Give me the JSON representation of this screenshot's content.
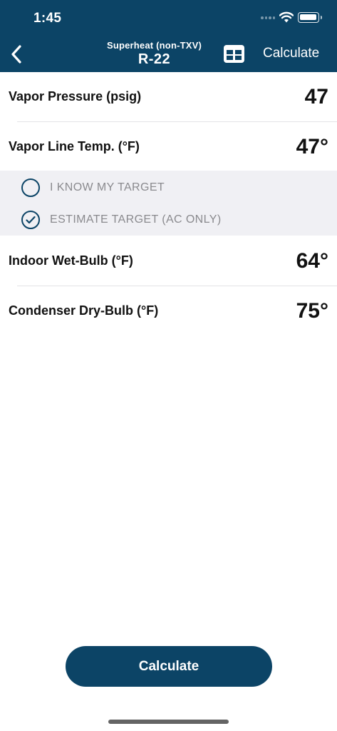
{
  "status_bar": {
    "time": "1:45",
    "icons": [
      "signal-icon",
      "wifi-icon",
      "battery-icon"
    ]
  },
  "nav": {
    "back_icon": "chevron-left-icon",
    "subtitle": "Superheat (non-TXV)",
    "title": "R-22",
    "table_icon": "table-icon",
    "calculate_label": "Calculate"
  },
  "fields": [
    {
      "label": "Vapor Pressure (psig)",
      "value": "47"
    },
    {
      "label": "Vapor Line Temp. (°F)",
      "value": "47°"
    },
    {
      "label": "Indoor Wet-Bulb (°F)",
      "value": "64°"
    },
    {
      "label": "Condenser Dry-Bulb (°F)",
      "value": "75°"
    }
  ],
  "target_options": [
    {
      "label": "I KNOW MY TARGET",
      "selected": false
    },
    {
      "label": "ESTIMATE TARGET (AC ONLY)",
      "selected": true
    }
  ],
  "calculate_button": {
    "label": "Calculate"
  },
  "colors": {
    "primary": "#0c4466",
    "panel": "#f0f0f4",
    "muted_text": "#8a8a8e"
  }
}
